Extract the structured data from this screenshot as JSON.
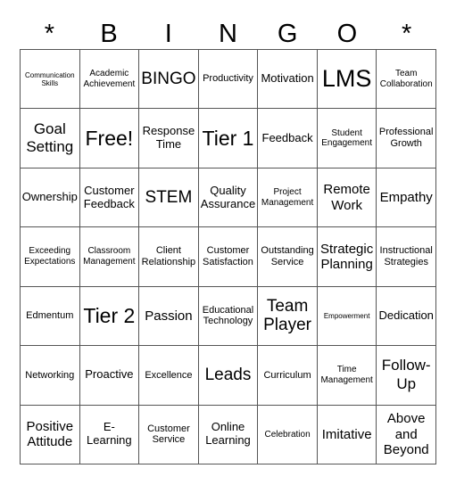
{
  "header": [
    "*",
    "B",
    "I",
    "N",
    "G",
    "O",
    "*"
  ],
  "cells": [
    {
      "text": "Communication Skills",
      "size": "s1"
    },
    {
      "text": "Academic Achievement",
      "size": "s2"
    },
    {
      "text": "BINGO",
      "size": "s7"
    },
    {
      "text": "Productivity",
      "size": "s3"
    },
    {
      "text": "Motivation",
      "size": "s4"
    },
    {
      "text": "LMS",
      "size": "s9"
    },
    {
      "text": "Team Collaboration",
      "size": "s2"
    },
    {
      "text": "Goal Setting",
      "size": "s6"
    },
    {
      "text": "Free!",
      "size": "s8"
    },
    {
      "text": "Response Time",
      "size": "s4"
    },
    {
      "text": "Tier 1",
      "size": "s8"
    },
    {
      "text": "Feedback",
      "size": "s4"
    },
    {
      "text": "Student Engagement",
      "size": "s2"
    },
    {
      "text": "Professional Growth",
      "size": "s3"
    },
    {
      "text": "Ownership",
      "size": "s4"
    },
    {
      "text": "Customer Feedback",
      "size": "s4"
    },
    {
      "text": "STEM",
      "size": "s7"
    },
    {
      "text": "Quality Assurance",
      "size": "s4"
    },
    {
      "text": "Project Management",
      "size": "s2"
    },
    {
      "text": "Remote Work",
      "size": "s5"
    },
    {
      "text": "Empathy",
      "size": "s5"
    },
    {
      "text": "Exceeding Expectations",
      "size": "s2"
    },
    {
      "text": "Classroom Management",
      "size": "s2"
    },
    {
      "text": "Client Relationship",
      "size": "s3"
    },
    {
      "text": "Customer Satisfaction",
      "size": "s3"
    },
    {
      "text": "Outstanding Service",
      "size": "s3"
    },
    {
      "text": "Strategic Planning",
      "size": "s5"
    },
    {
      "text": "Instructional Strategies",
      "size": "s3"
    },
    {
      "text": "Edmentum",
      "size": "s3"
    },
    {
      "text": "Tier 2",
      "size": "s8"
    },
    {
      "text": "Passion",
      "size": "s5"
    },
    {
      "text": "Educational Technology",
      "size": "s3"
    },
    {
      "text": "Team Player",
      "size": "s7"
    },
    {
      "text": "Empowerment",
      "size": "s1"
    },
    {
      "text": "Dedication",
      "size": "s4"
    },
    {
      "text": "Networking",
      "size": "s3"
    },
    {
      "text": "Proactive",
      "size": "s4"
    },
    {
      "text": "Excellence",
      "size": "s3"
    },
    {
      "text": "Leads",
      "size": "s7"
    },
    {
      "text": "Curriculum",
      "size": "s3"
    },
    {
      "text": "Time Management",
      "size": "s2"
    },
    {
      "text": "Follow-Up",
      "size": "s6"
    },
    {
      "text": "Positive Attitude",
      "size": "s5"
    },
    {
      "text": "E-Learning",
      "size": "s4"
    },
    {
      "text": "Customer Service",
      "size": "s3"
    },
    {
      "text": "Online Learning",
      "size": "s4"
    },
    {
      "text": "Celebration",
      "size": "s2"
    },
    {
      "text": "Imitative",
      "size": "s5"
    },
    {
      "text": "Above and Beyond",
      "size": "s5"
    }
  ]
}
